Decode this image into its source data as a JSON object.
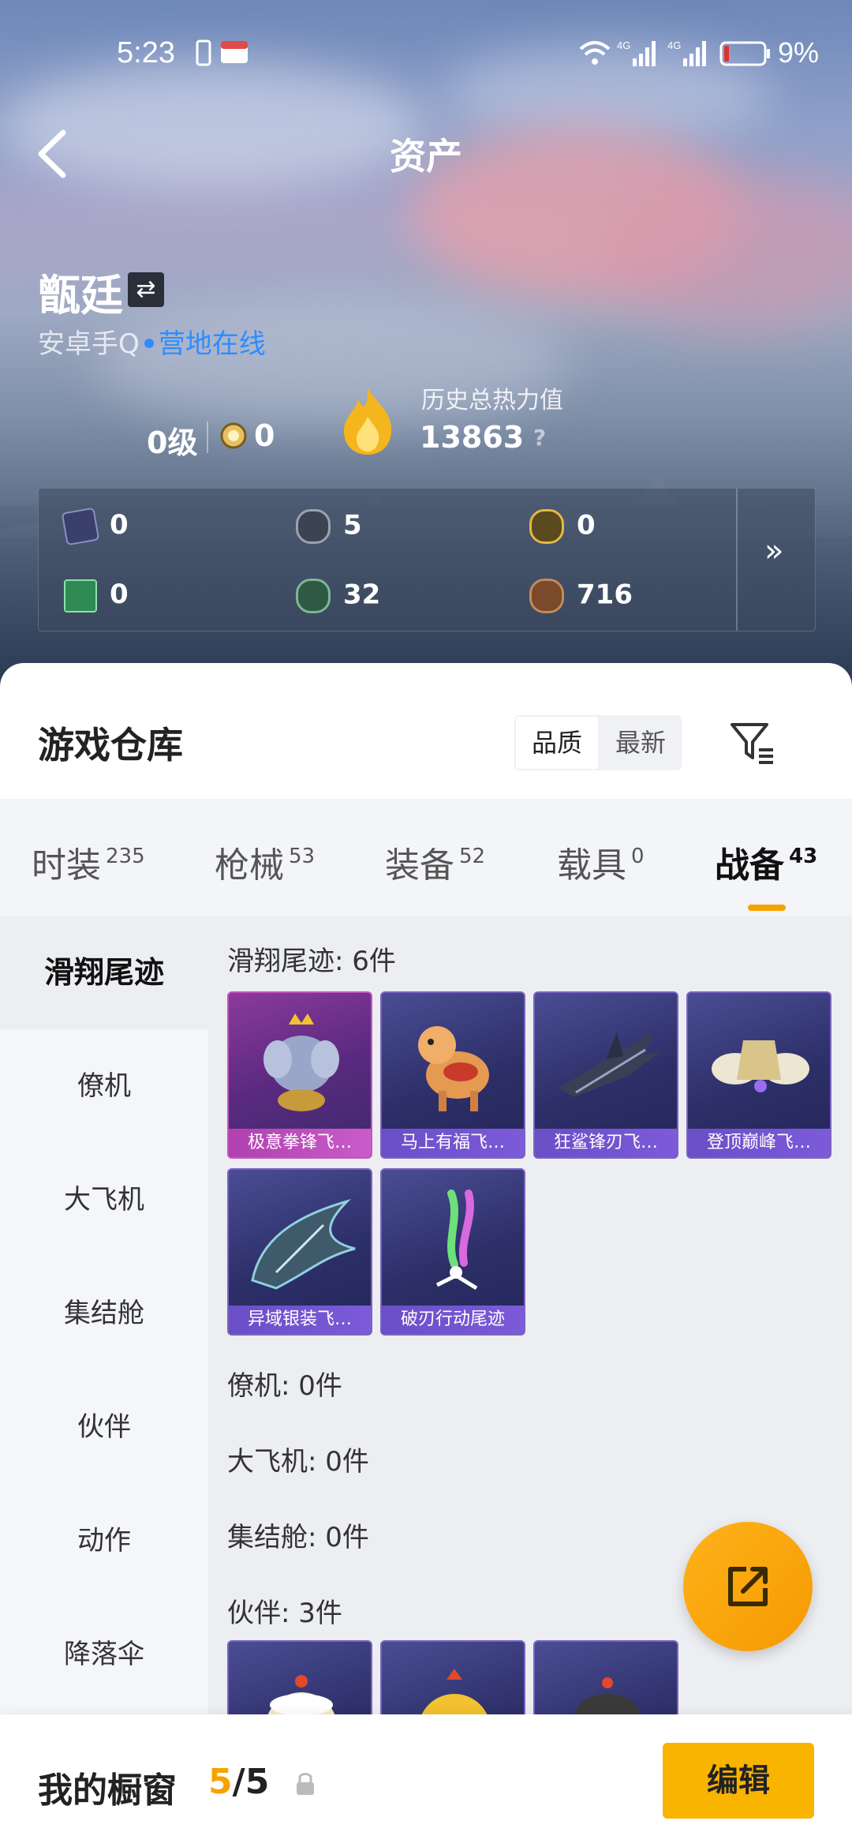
{
  "status_bar": {
    "time": "5:23",
    "battery": "9%",
    "network": [
      "4G",
      "4G"
    ]
  },
  "header": {
    "title": "资产"
  },
  "profile": {
    "name": "甑廷",
    "platform": "安卓手Q",
    "status": "营地在线",
    "level": "0级",
    "badge_value": "0",
    "heat_label": "历史总热力值",
    "heat_value": "13863",
    "help": "?"
  },
  "currencies": [
    {
      "icon": "card-icon",
      "value": "0"
    },
    {
      "icon": "silver-coin-icon",
      "value": "5"
    },
    {
      "icon": "gold-coin-icon",
      "value": "0"
    },
    {
      "icon": "ticket-icon",
      "value": "0"
    },
    {
      "icon": "green-coin-icon",
      "value": "32"
    },
    {
      "icon": "bronze-coin-icon",
      "value": "716"
    }
  ],
  "more": "»",
  "warehouse": {
    "title": "游戏仓库",
    "sort_options": [
      "品质",
      "最新"
    ],
    "tabs": [
      {
        "label": "时装",
        "count": "235"
      },
      {
        "label": "枪械",
        "count": "53"
      },
      {
        "label": "装备",
        "count": "52"
      },
      {
        "label": "载具",
        "count": "0"
      },
      {
        "label": "战备",
        "count": "43"
      }
    ],
    "categories": [
      "滑翔尾迹",
      "僚机",
      "大飞机",
      "集结舱",
      "伙伴",
      "动作",
      "降落伞"
    ],
    "sections": [
      {
        "title": "滑翔尾迹: 6件",
        "items": [
          "极意拳锋飞…",
          "马上有福飞…",
          "狂鲨锋刃飞…",
          "登顶巅峰飞…",
          "异域银装飞…",
          "破刃行动尾迹"
        ]
      },
      {
        "title": "僚机: 0件"
      },
      {
        "title": "大飞机: 0件"
      },
      {
        "title": "集结舱: 0件"
      },
      {
        "title": "伙伴: 3件"
      }
    ]
  },
  "showcase": {
    "title": "我的橱窗",
    "used": "5",
    "total": "/5",
    "edit": "编辑"
  },
  "colors": {
    "accent": "#f6a300",
    "link": "#2f8cff",
    "card_purple": "#2d2f68",
    "card_pink": "#8b3a9c"
  }
}
